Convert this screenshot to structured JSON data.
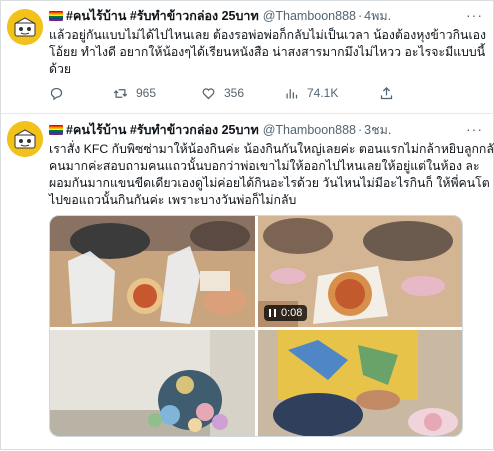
{
  "tweets": [
    {
      "display_name": "#คนไร้บ้าน #รับทำข้าวกล่อง 25บาท",
      "handle": "@Thamboon888",
      "time": "4พม.",
      "text_lines": [
        "แล้วอยู่กันแบบไม่ได้ไปไหนเลย ต้องรอพ่อพ่อก็กลับไม่เป็นเวลา น้องต้องหุงข้าวกินเอง",
        "โอ้ยย ทำไงดี อยากให้น้องๆได้เรียนหนังสือ น่าสงสารมากมึงไม่ไหวว อะไรจะมีแบบนี้",
        "ด้วย"
      ],
      "reply_count": "",
      "retweet_count": "965",
      "like_count": "356",
      "view_count": "74.1K"
    },
    {
      "display_name": "#คนไร้บ้าน #รับทำข้าวกล่อง 25บาท",
      "handle": "@Thamboon888",
      "time": "3ชม.",
      "text_lines": [
        "เราสั่ง KFC กับพิซซ่ามาให้น้องกินค่ะ น้องกินกันใหญ่เลยค่ะ ตอนแรกไม่กล้าหยิบลูกกลัว",
        "คนมากค่ะสอบถามคนแถวนั้นบอกว่าพ่อเขาไม่ให้ออกไปไหนเลยให้อยู่แต่ในห้อง ละ",
        "ผอมกันมากแขนขีดเดียวเองดูไม่ค่อยได้กินอะไรด้วย วันไหนไม่มีอะไรกินก็ ให้พี่คนโต",
        "ไปขอแถวนั้นกินกันค่ะ เพราะบางวันพ่อก็ไม่กลับ"
      ],
      "video_duration": "0:08"
    }
  ],
  "icons": {
    "avatar": "rice-box-logo-icon",
    "more": "more-dots-icon",
    "reply": "reply-icon",
    "retweet": "retweet-icon",
    "like": "heart-icon",
    "views": "views-bar-chart-icon",
    "share": "share-icon",
    "pause": "pause-icon"
  },
  "colors": {
    "text": "#0f1419",
    "secondary": "#536471",
    "avatar_bg": "#f2c11a"
  }
}
